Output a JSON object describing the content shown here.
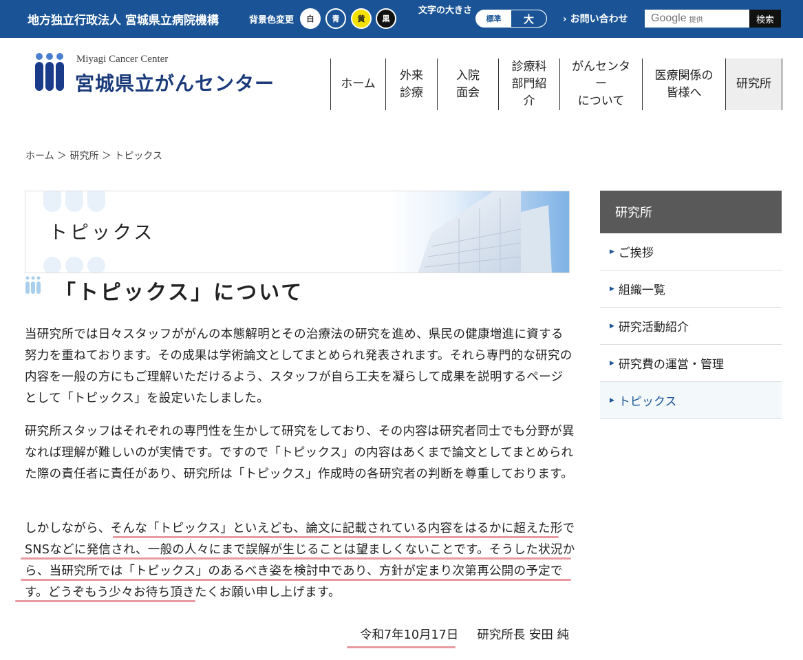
{
  "topbar": {
    "org_name": "地方独立行政法人 宮城県立病院機構",
    "bg_change_label": "背景色変更",
    "bg_options": [
      {
        "label": "白",
        "bg": "#ffffff",
        "fg": "#222222"
      },
      {
        "label": "青",
        "bg": "#1a5496",
        "fg": "#ffffff"
      },
      {
        "label": "黄",
        "bg": "#f5e100",
        "fg": "#222222"
      },
      {
        "label": "黒",
        "bg": "#111111",
        "fg": "#ffffff"
      }
    ],
    "font_size_label": "文字の大きさ",
    "font_size_standard": "標準",
    "font_size_large": "大",
    "contact_label": "お問い合わせ",
    "search_logo": "Google",
    "search_provided": "提供",
    "search_button": "検索"
  },
  "header": {
    "logo_en": "Miyagi Cancer Center",
    "logo_ja": "宮城県立がんセンター",
    "nav": [
      {
        "label": "ホーム",
        "active": false
      },
      {
        "label": "外来\n診療",
        "active": false
      },
      {
        "label": "入院\n面会",
        "active": false
      },
      {
        "label": "診療科\n部門紹\n介",
        "active": false
      },
      {
        "label": "がんセンタ\nー\nについて",
        "active": false
      },
      {
        "label": "医療関係の\n皆様へ",
        "active": false
      },
      {
        "label": "研究所",
        "active": true
      }
    ]
  },
  "breadcrumb": {
    "items": [
      "ホーム",
      "研究所",
      "トピックス"
    ],
    "separator": "＞"
  },
  "banner": {
    "title": "トピックス"
  },
  "main": {
    "heading": "「トピックス」について",
    "paragraph1": "当研究所では日々スタッフががんの本態解明とその治療法の研究を進め、県民の健康増進に資する努力を重ねております。その成果は学術論文としてまとめられ発表されます。それら専門的な研究の内容を一般の方にもご理解いただけるよう、スタッフが自ら工夫を凝らして成果を説明するページとして「トピックス」を設定いたしました。",
    "paragraph2": "研究所スタッフはそれぞれの専門性を生かして研究をしており、その内容は研究者同士でも分野が異なれば理解が難しいのが実情です。ですので「トピックス」の内容はあくまで論文としてまとめられた際の責任者に責任があり、研究所は「トピックス」作成時の各研究者の判断を尊重しております。",
    "paragraph3": "しかしながら、そんな「トピックス」といえども、論文に記載されている内容をはるかに超えた形でSNSなどに発信され、一般の人々にまで誤解が生じることは望ましくないことです。そうした状況から、当研究所では「トピックス」のあるべき姿を検討中であり、方針が定まり次第再公開の予定です。どうぞもう少々お待ち頂きたくお願い申し上げます。",
    "sign_date": "令和7年10月17日",
    "sign_author": "研究所長 安田 純"
  },
  "sidebar": {
    "title": "研究所",
    "items": [
      {
        "label": "ご挨拶",
        "active": false
      },
      {
        "label": "組織一覧",
        "active": false
      },
      {
        "label": "研究活動紹介",
        "active": false
      },
      {
        "label": "研究費の運営・管理",
        "active": false
      },
      {
        "label": "トピックス",
        "active": true
      }
    ]
  },
  "colors": {
    "topbar": "#1a5496",
    "sidebar_head": "#595959",
    "highlight_underline": "#e79aa0"
  }
}
